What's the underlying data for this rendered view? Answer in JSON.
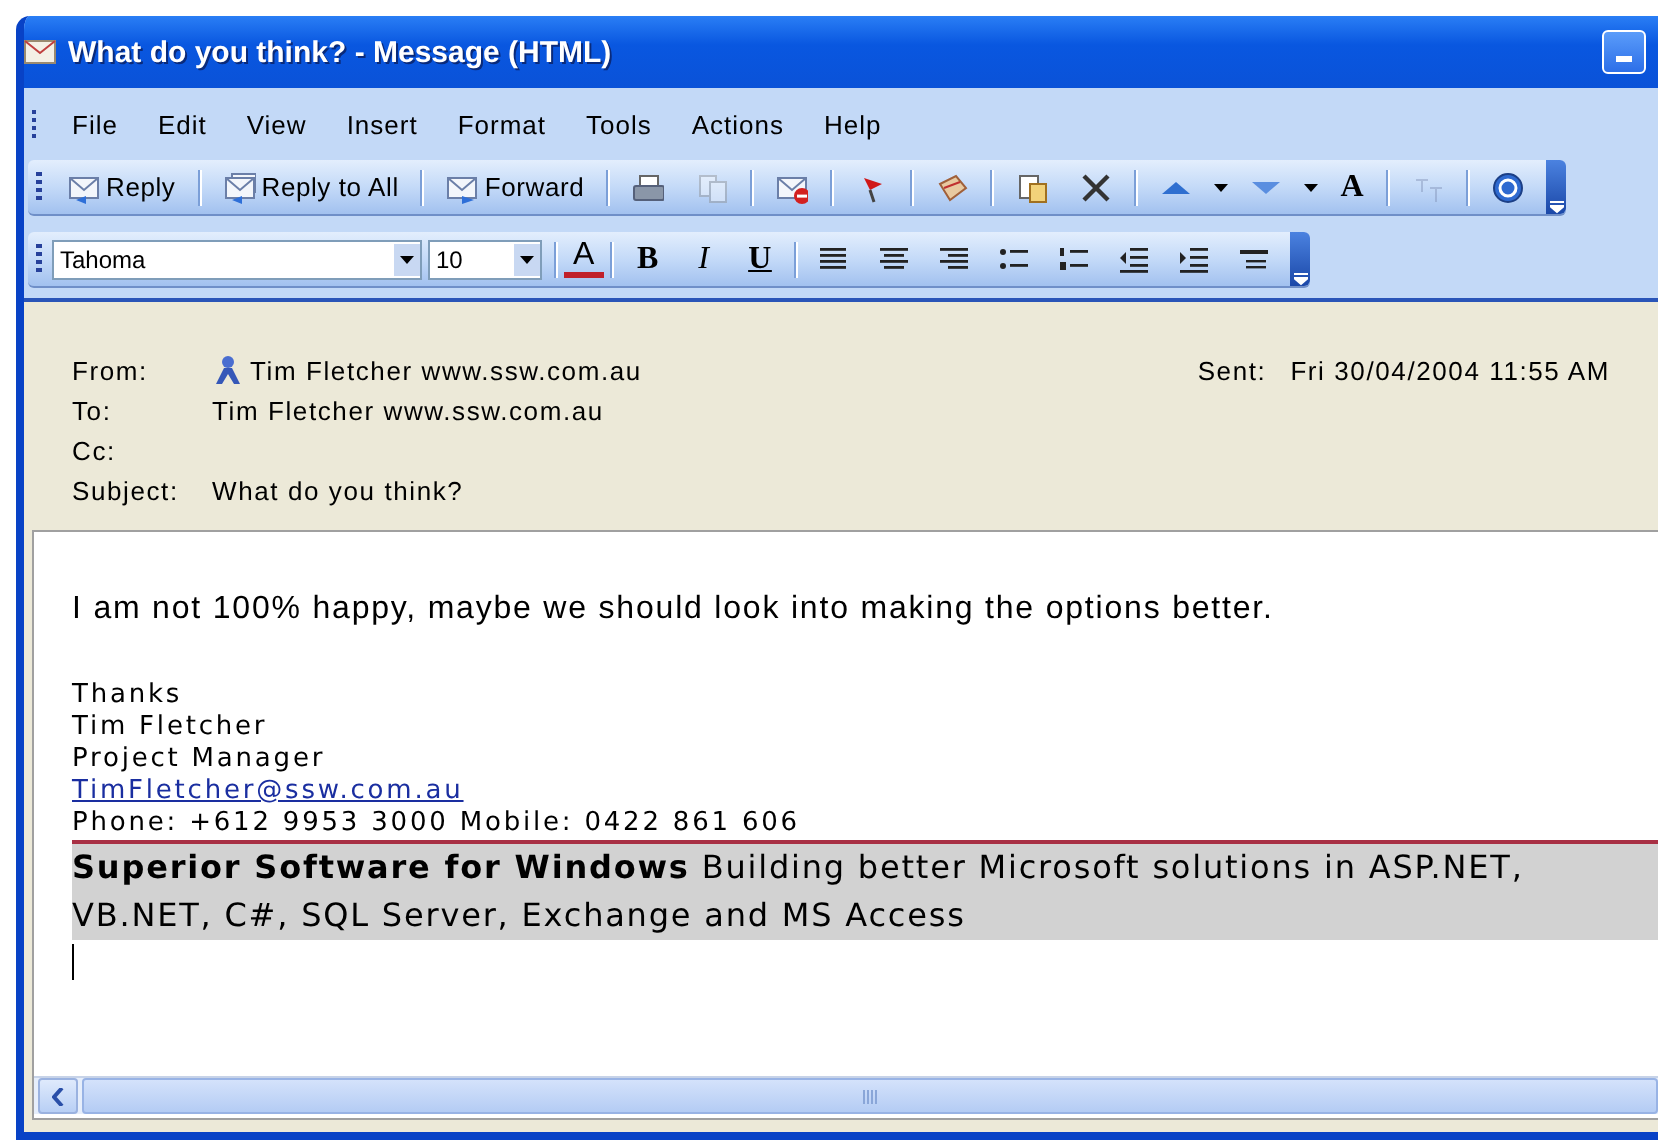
{
  "window": {
    "title": "What do you think? - Message (HTML)"
  },
  "menu": [
    {
      "label": "File"
    },
    {
      "label": "Edit"
    },
    {
      "label": "View"
    },
    {
      "label": "Insert"
    },
    {
      "label": "Format"
    },
    {
      "label": "Tools"
    },
    {
      "label": "Actions"
    },
    {
      "label": "Help"
    }
  ],
  "standard_toolbar": [
    {
      "kind": "labeled",
      "label": "Reply",
      "disabled": false
    },
    {
      "kind": "separator"
    },
    {
      "kind": "labeled",
      "label": "Reply to All",
      "disabled": false
    },
    {
      "kind": "separator"
    },
    {
      "kind": "labeled",
      "label": "Forward",
      "disabled": false
    },
    {
      "kind": "separator"
    },
    {
      "kind": "icon",
      "disabled": false
    },
    {
      "kind": "icon",
      "disabled": true
    },
    {
      "kind": "separator"
    },
    {
      "kind": "icon",
      "disabled": false
    },
    {
      "kind": "separator"
    },
    {
      "kind": "icon",
      "disabled": false
    },
    {
      "kind": "separator"
    },
    {
      "kind": "icon",
      "disabled": false
    },
    {
      "kind": "separator"
    },
    {
      "kind": "icon",
      "disabled": false
    },
    {
      "kind": "icon",
      "disabled": false
    },
    {
      "kind": "separator"
    },
    {
      "kind": "icon",
      "disabled": false
    },
    {
      "kind": "caret"
    },
    {
      "kind": "icon",
      "disabled": false
    },
    {
      "kind": "caret"
    },
    {
      "kind": "letter",
      "label": "A",
      "disabled": false
    },
    {
      "kind": "separator"
    },
    {
      "kind": "icon",
      "disabled": true
    },
    {
      "kind": "separator"
    },
    {
      "kind": "icon",
      "disabled": false
    }
  ],
  "format_toolbar": {
    "font": "Tahoma",
    "size": "10",
    "items": [
      {
        "kind": "separator"
      },
      {
        "kind": "letter",
        "label": "A"
      },
      {
        "kind": "separator"
      },
      {
        "kind": "letter",
        "label": "B"
      },
      {
        "kind": "letter",
        "label": "I"
      },
      {
        "kind": "letter",
        "label": "U"
      },
      {
        "kind": "separator"
      },
      {
        "kind": "icon"
      },
      {
        "kind": "icon"
      },
      {
        "kind": "icon"
      },
      {
        "kind": "icon"
      },
      {
        "kind": "icon"
      },
      {
        "kind": "icon"
      },
      {
        "kind": "icon"
      },
      {
        "kind": "icon"
      }
    ]
  },
  "header": {
    "from_label": "From:",
    "from": "Tim Fletcher www.ssw.com.au",
    "sent_label": "Sent:",
    "sent": "Fri 30/04/2004 11:55 AM",
    "to_label": "To:",
    "to": "Tim Fletcher www.ssw.com.au",
    "cc_label": "Cc:",
    "subject_label": "Subject:",
    "subject": "What do you think?"
  },
  "body": {
    "message": "I am not 100% happy, maybe we should look into making the options better.",
    "signature": [
      {
        "kind": "text",
        "text": "Thanks"
      },
      {
        "kind": "text",
        "text": "Tim Fletcher"
      },
      {
        "kind": "text",
        "text": "Project Manager"
      },
      {
        "kind": "link",
        "text": "TimFletcher@ssw.com.au"
      },
      {
        "kind": "text",
        "text": "Phone: +612 9953 3000 Mobile: 0422 861 606"
      }
    ],
    "banner": "**Superior Software for Windows** Building better Microsoft solutions in ASP.NET, VB.NET, C#, SQL Server, Exchange and MS Access"
  }
}
